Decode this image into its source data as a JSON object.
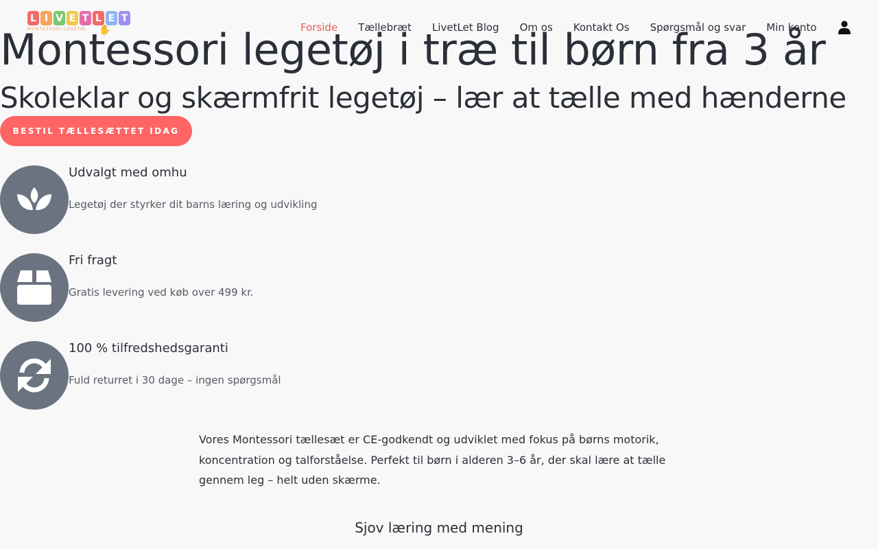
{
  "brand": {
    "logo_letters": [
      "L",
      "I",
      "V",
      "E",
      "T",
      "L",
      "E",
      "T"
    ],
    "logo_colors": [
      "#f26b6b",
      "#f5a65b",
      "#7bc96f",
      "#f2c94c",
      "#e46ba8",
      "#f26b6b",
      "#8fb6f2",
      "#9b8ff2"
    ],
    "logo_subtitle": "MONTESSORI LEGETØJ"
  },
  "nav": {
    "items": [
      {
        "label": "Forside",
        "active": true
      },
      {
        "label": "Tællebræt"
      },
      {
        "label": "LivetLet Blog"
      },
      {
        "label": "Om os"
      },
      {
        "label": "Kontakt Os"
      },
      {
        "label": "Spørgsmål og svar"
      },
      {
        "label": "Min konto"
      }
    ],
    "user_icon": "user-icon"
  },
  "hero": {
    "title": "Montessori legetøj i træ til børn fra 3 år",
    "subtitle": "Skoleklar og skærmfrit legetøj – lær at tælle med hænderne",
    "cta_label": "BESTIL TÆLLESÆTTET IDAG"
  },
  "features": [
    {
      "icon": "lotus-icon",
      "title": "Udvalgt med omhu",
      "text": "Legetøj der styrker dit barns læring og udvikling"
    },
    {
      "icon": "box-icon",
      "title": "Fri fragt",
      "text": "Gratis levering ved køb over 499 kr."
    },
    {
      "icon": "refresh-icon",
      "title": "100 % tilfredshedsgaranti",
      "text": "Fuld returret i 30 dage – ingen spørgsmål"
    }
  ],
  "content": {
    "body": "Vores Montessori tællesæt er CE-godkendt og udviklet med fokus på børns motorik, koncentration og talforståelse. Perfekt til børn i alderen 3–6 år, der skal lære at tælle gennem leg – helt uden skærme.",
    "section_title": "Sjov læring med mening"
  },
  "colors": {
    "accent": "#f05a5a",
    "cta": "#ff6565",
    "icon_circle": "#6b7280",
    "text": "#2b2f38"
  }
}
